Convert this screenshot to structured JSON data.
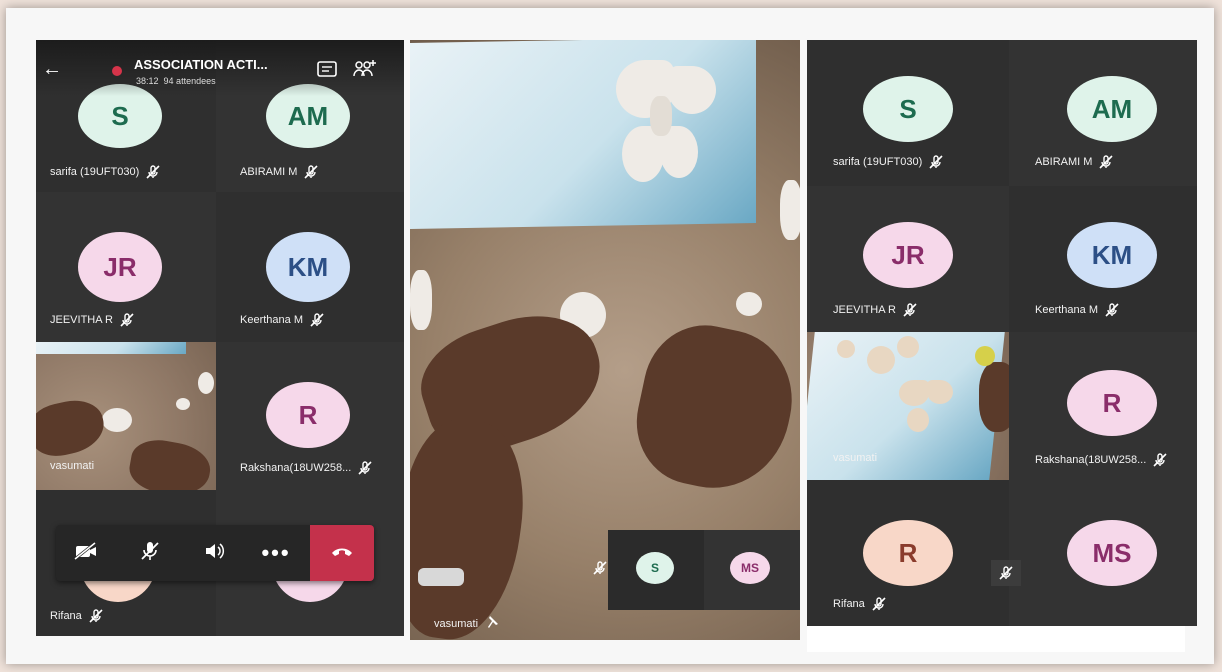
{
  "meeting": {
    "title": "ASSOCIATION ACTI...",
    "duration": "38:12",
    "attendees": "94 attendees"
  },
  "colors": {
    "end_call": "#c4314b",
    "recording": "#d6344a",
    "avatar_green": "#dff3ea",
    "avatar_pink": "#f6d8ea",
    "avatar_blue": "#cfe0f7",
    "avatar_peach": "#f8d7c8"
  },
  "left_panel": {
    "participants": [
      {
        "initials": "S",
        "name": "sarifa (19UFT030)"
      },
      {
        "initials": "AM",
        "name": "ABIRAMI M"
      },
      {
        "initials": "JR",
        "name": "JEEVITHA R"
      },
      {
        "initials": "KM",
        "name": "Keerthana M"
      },
      {
        "initials": "",
        "name": "vasumati"
      },
      {
        "initials": "R",
        "name": "Rakshana(18UW258..."
      },
      {
        "initials": "",
        "name": "Rifana"
      }
    ],
    "toolbar": [
      "camera-off-icon",
      "mic-off-icon",
      "speaker-icon",
      "more-icon",
      "hang-up-icon"
    ]
  },
  "center_panel": {
    "presenter": "vasumati",
    "thumbnails": [
      {
        "initials": "S"
      },
      {
        "initials": "MS"
      }
    ]
  },
  "right_panel": {
    "participants": [
      {
        "initials": "S",
        "name": "sarifa (19UFT030)"
      },
      {
        "initials": "AM",
        "name": "ABIRAMI M"
      },
      {
        "initials": "JR",
        "name": "JEEVITHA R"
      },
      {
        "initials": "KM",
        "name": "Keerthana M"
      },
      {
        "initials": "",
        "name": "vasumati"
      },
      {
        "initials": "R",
        "name": "Rakshana(18UW258..."
      },
      {
        "initials": "R",
        "name": "Rifana"
      },
      {
        "initials": "MS",
        "name": ""
      }
    ]
  }
}
